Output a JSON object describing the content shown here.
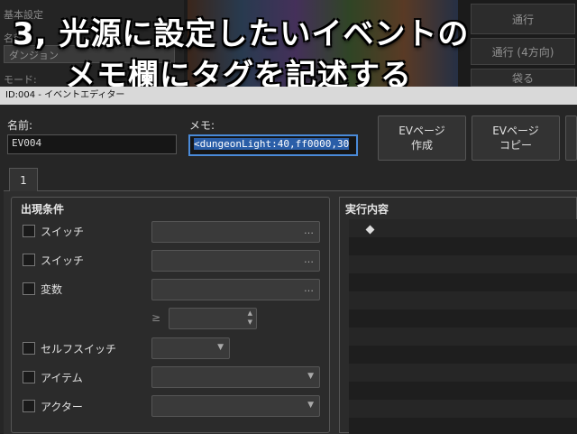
{
  "background": {
    "label_basic": "基本設定",
    "label_name": "名前:",
    "name_value": "ダンジョン",
    "label_mode": "モード:",
    "btn_walk": "通行",
    "btn_walk4": "通行 (4方向)",
    "btn_other": "袋る"
  },
  "caption": {
    "line1": "3, 光源に設定したいイベントの",
    "line2": "メモ欄にタグを記述する"
  },
  "window": {
    "title": "ID:004 - イベントエディター"
  },
  "editor": {
    "name_label": "名前:",
    "name_value": "EV004",
    "memo_label": "メモ:",
    "memo_value": "<dungeonLight:40,ff0000,30",
    "buttons": [
      {
        "line1": "EVページ",
        "line2": "作成"
      },
      {
        "line1": "EVページ",
        "line2": "コピー"
      }
    ],
    "tab_label": "1",
    "conditions_title": "出現条件",
    "conditions": [
      {
        "label": "スイッチ",
        "type": "dots"
      },
      {
        "label": "スイッチ",
        "type": "dots"
      },
      {
        "label": "変数",
        "type": "dots"
      },
      {
        "label": "セルフスイッチ",
        "type": "dropdown"
      },
      {
        "label": "アイテム",
        "type": "dropdown"
      },
      {
        "label": "アクター",
        "type": "dropdown"
      }
    ],
    "ge_symbol": "≥",
    "dots": "…",
    "dropdown_arrow": "▼",
    "spin_up": "▲",
    "spin_down": "▼",
    "exec_title": "実行内容",
    "exec_marker": "◆"
  },
  "colors": {
    "accent": "#4a8ad8",
    "selection": "#2a5ea8"
  }
}
